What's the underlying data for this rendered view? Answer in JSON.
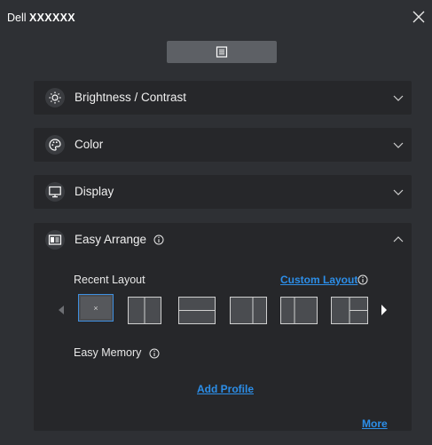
{
  "window": {
    "title_brand": "Dell",
    "title_model": "XXXXXX"
  },
  "colors": {
    "background": "#2e3034",
    "panel": "#26272a",
    "accent_link": "#2c8ee8",
    "selected_outline": "#3f8fe0",
    "tile_fill": "#4a4c50",
    "tile_line": "#cfcfcf"
  },
  "icons": {
    "close": "close-icon",
    "menu": "menu-list-icon",
    "brightness": "sun-icon",
    "color": "palette-icon",
    "display": "monitor-icon",
    "easy_arrange": "window-layout-icon",
    "info": "info-icon",
    "expand": "chevron-down-icon",
    "collapse": "chevron-up-icon",
    "prev": "triangle-left-icon",
    "next": "triangle-right-icon"
  },
  "sections": {
    "brightness": {
      "label": "Brightness / Contrast",
      "expanded": false
    },
    "color": {
      "label": "Color",
      "expanded": false
    },
    "display": {
      "label": "Display",
      "expanded": false
    },
    "easy_arrange": {
      "label": "Easy Arrange",
      "expanded": true
    }
  },
  "easy_arrange": {
    "recent_layout_label": "Recent Layout",
    "custom_layout_link": "Custom Layout",
    "selected_tile_text": "×",
    "layouts": [
      {
        "id": "none",
        "selected": true
      },
      {
        "id": "two-columns",
        "selected": false
      },
      {
        "id": "two-rows",
        "selected": false
      },
      {
        "id": "two-columns-wide-right",
        "selected": false
      },
      {
        "id": "two-columns-wide-left",
        "selected": false
      },
      {
        "id": "left-plus-two-right",
        "selected": false
      }
    ],
    "easy_memory_label": "Easy Memory",
    "add_profile_link": "Add Profile",
    "more_link": "More"
  }
}
